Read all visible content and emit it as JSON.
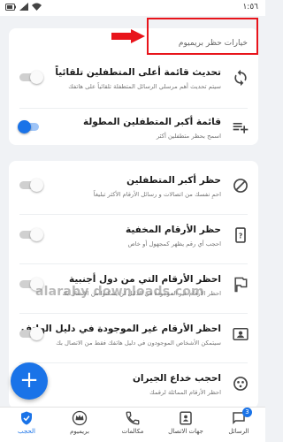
{
  "status_bar": {
    "time": "١:٥٦"
  },
  "premium_section": {
    "title": "خيارات حظر بريميوم"
  },
  "settings": [
    {
      "title": "تحديث قائمة أعلى المتطفلين تلقائياً",
      "description": "سيتم تحديث أهم مرسلي الرسائل المتطفلة تلقائياً على هاتفك",
      "enabled": false,
      "icon": "sync-icon"
    },
    {
      "title": "قائمة أكبر المتطفلين المطولة",
      "description": "اسمح بحظر متطفلين أكثر",
      "enabled": true,
      "icon": "playlist-add-icon"
    },
    {
      "title": "حظر أكبر المتطفلين",
      "description": "احمِ نفسك من اتصالات و رسائل الأرقام الأكثر تبليغاً",
      "enabled": false,
      "icon": "block-icon"
    },
    {
      "title": "حظر الأرقام المخفية",
      "description": "احجب أي رقم يظهر كمجهول أو خاص",
      "enabled": false,
      "icon": "unknown-number-icon"
    },
    {
      "title": "احظر الأرقام التي من دول أجنبية",
      "description": "احظر الأرقام غير الموجودة في الدليل لن يتمكنوا من الاتصال بك",
      "enabled": false,
      "icon": "flag-icon"
    },
    {
      "title": "احظر الأرقام غير الموجودة في دليل الهاتف",
      "description": "سيتمكن الأشخاص الموجودون في دليل هاتفك فقط من الاتصال بك",
      "enabled": false,
      "icon": "contact-card-icon"
    },
    {
      "title": "احجب خداع الجيران",
      "description": "احظر الأرقام المماثلة لرقمك",
      "enabled": false,
      "icon": "neighbor-spoof-icon"
    }
  ],
  "watermark": "alaraby downloads.com",
  "fab": {
    "label": "+"
  },
  "bottom_nav": [
    {
      "label": "الرسائل",
      "badge": "3"
    },
    {
      "label": "جهات الاتصال"
    },
    {
      "label": "مكالمات"
    },
    {
      "label": "بريميوم"
    },
    {
      "label": "الحجب"
    }
  ],
  "colors": {
    "accent": "#1a73e8",
    "highlight": "#e8141b",
    "background": "#f0f2f5"
  }
}
